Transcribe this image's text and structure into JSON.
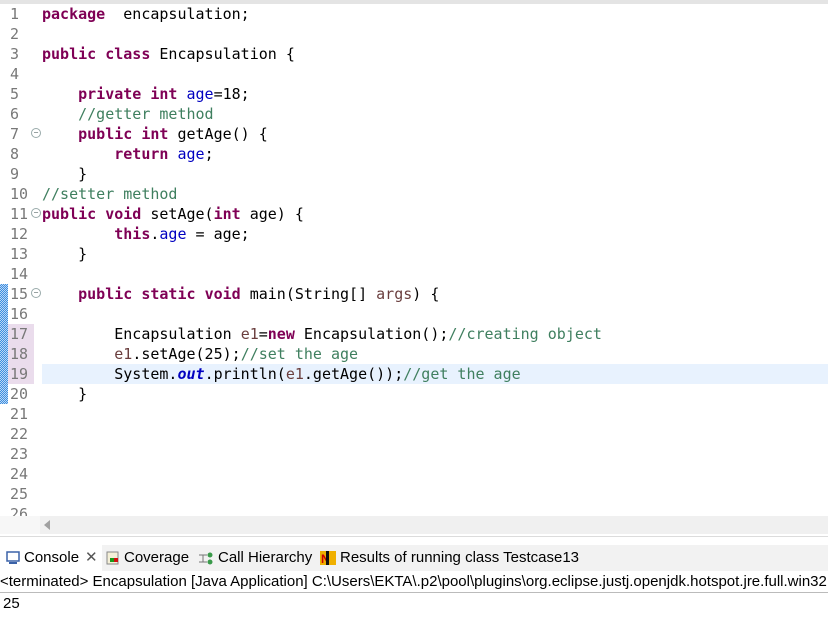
{
  "editor": {
    "lines": [
      [
        [
          "kw",
          "package"
        ],
        [
          "",
          "  encapsulation;"
        ]
      ],
      [],
      [
        [
          "kw",
          "public"
        ],
        [
          "",
          " "
        ],
        [
          "kw",
          "class"
        ],
        [
          "",
          " Encapsulation {"
        ]
      ],
      [],
      [
        [
          "",
          "    "
        ],
        [
          "kw",
          "private"
        ],
        [
          "",
          " "
        ],
        [
          "kw",
          "int"
        ],
        [
          "",
          " "
        ],
        [
          "fd",
          "age"
        ],
        [
          "",
          "=18;"
        ]
      ],
      [
        [
          "",
          "    "
        ],
        [
          "cm",
          "//getter method"
        ]
      ],
      [
        [
          "",
          "    "
        ],
        [
          "kw",
          "public"
        ],
        [
          "",
          " "
        ],
        [
          "kw",
          "int"
        ],
        [
          "",
          " getAge() {"
        ]
      ],
      [
        [
          "",
          "        "
        ],
        [
          "kw",
          "return"
        ],
        [
          "",
          " "
        ],
        [
          "fd",
          "age"
        ],
        [
          "",
          ";"
        ]
      ],
      [
        [
          "",
          "    }"
        ]
      ],
      [
        [
          "cm",
          "//setter method"
        ]
      ],
      [
        [
          "kw",
          "public"
        ],
        [
          "",
          " "
        ],
        [
          "kw",
          "void"
        ],
        [
          "",
          " setAge("
        ],
        [
          "kw",
          "int"
        ],
        [
          "",
          " age) {"
        ]
      ],
      [
        [
          "",
          "        "
        ],
        [
          "kw",
          "this"
        ],
        [
          "",
          "."
        ],
        [
          "fd",
          "age"
        ],
        [
          "",
          " = age;"
        ]
      ],
      [
        [
          "",
          "    }"
        ]
      ],
      [],
      [
        [
          "",
          "    "
        ],
        [
          "kw",
          "public"
        ],
        [
          "",
          " "
        ],
        [
          "kw",
          "static"
        ],
        [
          "",
          " "
        ],
        [
          "kw",
          "void"
        ],
        [
          "",
          " main(String[] "
        ],
        [
          "lv",
          "args"
        ],
        [
          "",
          ") {"
        ]
      ],
      [],
      [
        [
          "",
          "        Encapsulation "
        ],
        [
          "lv",
          "e1"
        ],
        [
          "",
          "="
        ],
        [
          "kw",
          "new"
        ],
        [
          "",
          " Encapsulation();"
        ],
        [
          "cm",
          "//creating object"
        ]
      ],
      [
        [
          "",
          "        "
        ],
        [
          "lv",
          "e1"
        ],
        [
          "",
          ".setAge(25);"
        ],
        [
          "cm",
          "//set the age"
        ]
      ],
      [
        [
          "",
          "        System."
        ],
        [
          "sf",
          "out"
        ],
        [
          "",
          ".println("
        ],
        [
          "lv",
          "e1"
        ],
        [
          "",
          ".getAge());"
        ],
        [
          "cm",
          "//get the age"
        ]
      ],
      [
        [
          "",
          "    }"
        ]
      ],
      [],
      [],
      [],
      [],
      [],
      []
    ],
    "current_line": 19,
    "fold_lines": [
      7,
      11,
      15
    ],
    "pink_lines": [
      17,
      18,
      19
    ]
  },
  "tabs": [
    {
      "label": "Console",
      "icon": "console-icon",
      "active": true,
      "closable": true
    },
    {
      "label": "Coverage",
      "icon": "coverage-icon"
    },
    {
      "label": "Call Hierarchy",
      "icon": "call-hierarchy-icon"
    },
    {
      "label": "Results of running class Testcase13",
      "icon": "testng-icon"
    }
  ],
  "console": {
    "header": "<terminated> Encapsulation [Java Application] C:\\Users\\EKTA\\.p2\\pool\\plugins\\org.eclipse.justj.openjdk.hotspot.jre.full.win32",
    "output": "25"
  }
}
